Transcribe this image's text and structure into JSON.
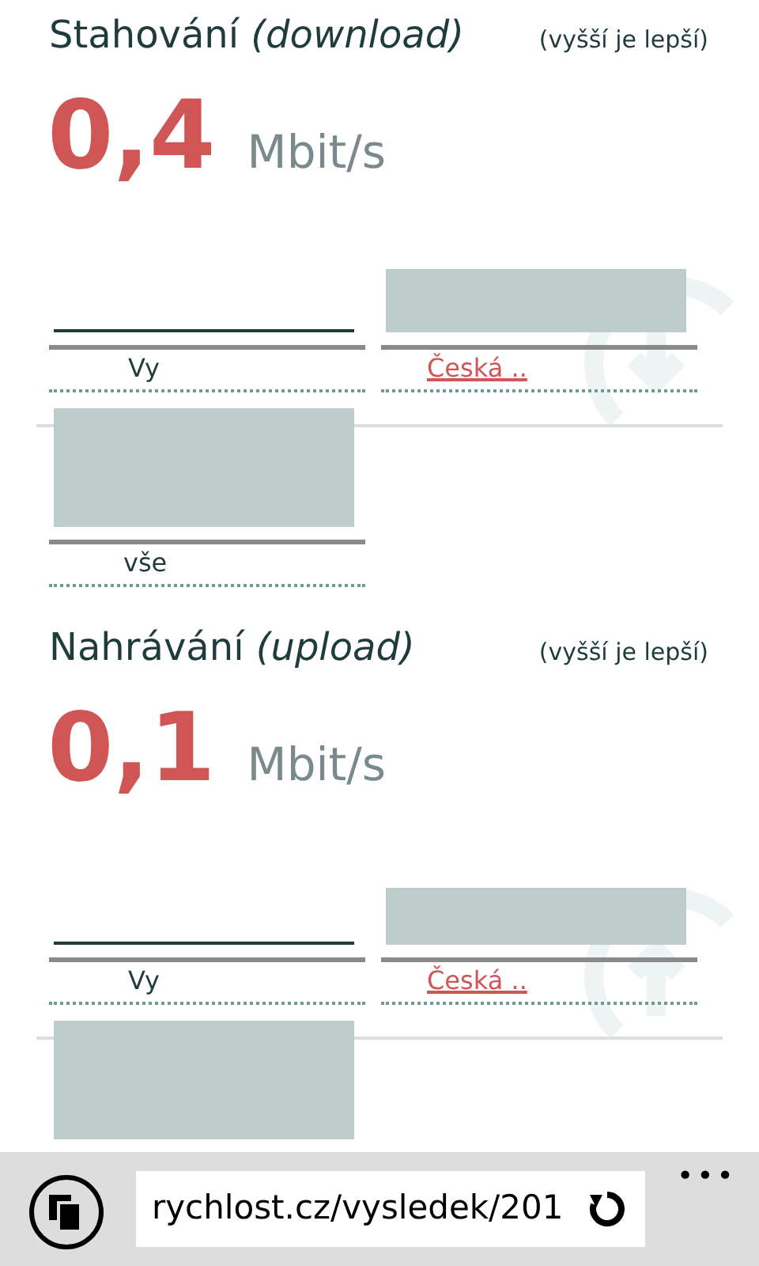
{
  "sections": [
    {
      "title": "Stahování *(download)*",
      "hint": "(vyšší je lepší)",
      "value": "0,4",
      "unit": "Mbit/s",
      "bars": [
        {
          "kind": "self",
          "label": "Vy"
        },
        {
          "kind": "reference",
          "label": "Česká .."
        }
      ],
      "total_bar": {
        "label": "vše"
      }
    },
    {
      "title": "Nahrávání *(upload)*",
      "hint": "(vyšší je lepší)",
      "value": "0,1",
      "unit": "Mbit/s",
      "bars": [
        {
          "kind": "self",
          "label": "Vy"
        },
        {
          "kind": "reference",
          "label": "Česká .."
        }
      ]
    }
  ],
  "browser_bar": {
    "address": "rychlost.cz/vysledek/201",
    "menu": "•••"
  }
}
